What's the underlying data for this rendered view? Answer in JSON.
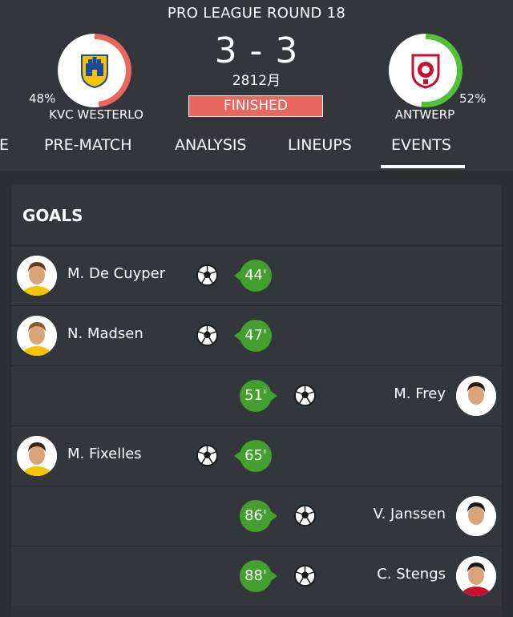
{
  "header": {
    "round_title": "PRO LEAGUE ROUND 18",
    "score": "3 - 3",
    "date": "2812月",
    "status": "FINISHED"
  },
  "home": {
    "name": "KVC WESTERLO",
    "percent_label": "48%",
    "possession": 0.48,
    "ring_color": "#e8685f"
  },
  "away": {
    "name": "ANTWERP",
    "percent_label": "52%",
    "possession": 0.52,
    "ring_color": "#4fc23a"
  },
  "tabs": [
    {
      "label": "E"
    },
    {
      "label": "PRE-MATCH"
    },
    {
      "label": "ANALYSIS"
    },
    {
      "label": "LINEUPS"
    },
    {
      "label": "EVENTS",
      "active": true
    }
  ],
  "goals_section": {
    "title": "GOALS",
    "events": [
      {
        "side": "home",
        "player": "M. De Cuyper",
        "minute": "44'"
      },
      {
        "side": "home",
        "player": "N. Madsen",
        "minute": "47'"
      },
      {
        "side": "away",
        "player": "M. Frey",
        "minute": "51'"
      },
      {
        "side": "home",
        "player": "M. Fixelles",
        "minute": "65'"
      },
      {
        "side": "away",
        "player": "V. Janssen",
        "minute": "86'"
      },
      {
        "side": "away",
        "player": "C. Stengs",
        "minute": "88'"
      }
    ]
  },
  "icons": {
    "goal": "soccer-ball-icon",
    "avatar": "player-avatar"
  },
  "colors": {
    "background": "#2b2e31",
    "row": "#33363a",
    "minute_badge": "#43a02f",
    "status_badge": "#e8685f"
  }
}
